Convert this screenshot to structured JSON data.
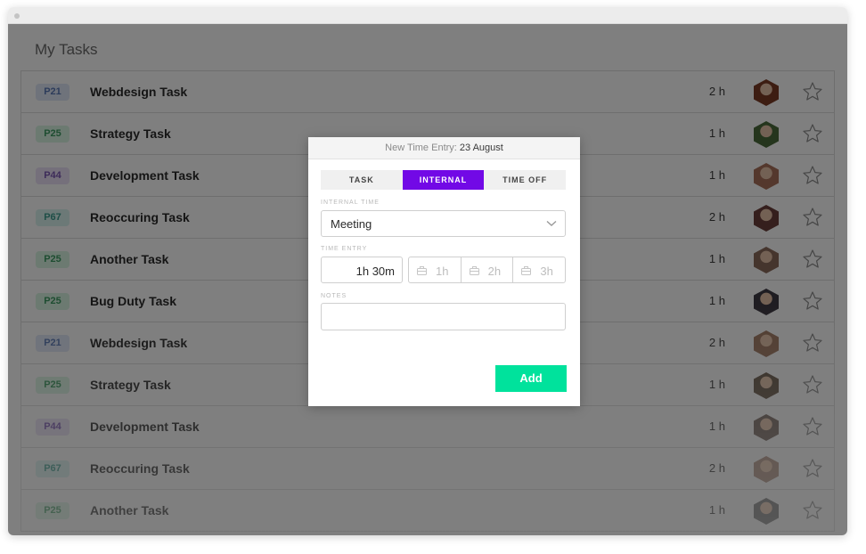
{
  "page": {
    "title": "My Tasks"
  },
  "colors": {
    "accent": "#7209e6",
    "add_button": "#00e29c",
    "badge_blue": "#dfe7f7",
    "badge_green": "#d9f5e3",
    "badge_purple": "#eae1f7",
    "badge_teal": "#d8f3ef"
  },
  "tasks": [
    {
      "code": "P21",
      "name": "Webdesign Task",
      "hours": "2 h",
      "badge": "blue"
    },
    {
      "code": "P25",
      "name": "Strategy Task",
      "hours": "1 h",
      "badge": "green"
    },
    {
      "code": "P44",
      "name": "Development Task",
      "hours": "1 h",
      "badge": "purple"
    },
    {
      "code": "P67",
      "name": "Reoccuring Task",
      "hours": "2 h",
      "badge": "teal"
    },
    {
      "code": "P25",
      "name": "Another Task",
      "hours": "1 h",
      "badge": "green"
    },
    {
      "code": "P25",
      "name": "Bug Duty Task",
      "hours": "1 h",
      "badge": "green"
    },
    {
      "code": "P21",
      "name": "Webdesign Task",
      "hours": "2 h",
      "badge": "blue"
    },
    {
      "code": "P25",
      "name": "Strategy Task",
      "hours": "1 h",
      "badge": "green"
    },
    {
      "code": "P44",
      "name": "Development Task",
      "hours": "1 h",
      "badge": "purple"
    },
    {
      "code": "P67",
      "name": "Reoccuring Task",
      "hours": "2 h",
      "badge": "teal"
    },
    {
      "code": "P25",
      "name": "Another Task",
      "hours": "1 h",
      "badge": "green"
    }
  ],
  "icons": {
    "row_favorite": "star-outline-icon",
    "row_avatar": "avatar-hexagon-icon",
    "preset": "briefcase-icon",
    "dropdown": "chevron-down-icon"
  },
  "modal": {
    "header_prefix": "New Time Entry:",
    "header_date": "23 August",
    "tabs": [
      {
        "label": "TASK",
        "active": false
      },
      {
        "label": "INTERNAL",
        "active": true
      },
      {
        "label": "TIME OFF",
        "active": false
      }
    ],
    "internal_time_label": "INTERNAL TIME",
    "internal_time_value": "Meeting",
    "time_entry_label": "TIME ENTRY",
    "time_entry_value": "1h 30m",
    "presets": [
      "1h",
      "2h",
      "3h"
    ],
    "notes_label": "NOTES",
    "notes_value": "",
    "add_label": "Add"
  }
}
